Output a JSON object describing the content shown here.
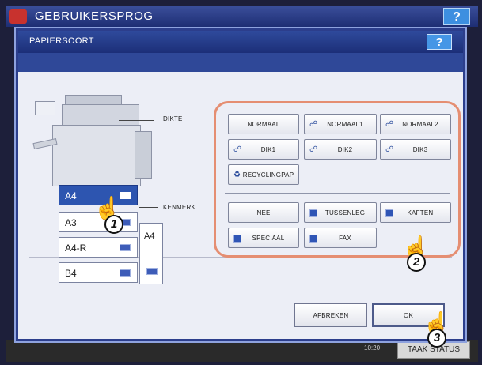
{
  "background": {
    "title": "GEBRUIKERSPROG",
    "help_label": "?",
    "date": "",
    "time": "10:20",
    "task_button_label": "TAAK STATUS"
  },
  "dialog": {
    "title": "PAPIERSOORT",
    "help_label": "?"
  },
  "labels": {
    "thickness": "DIKTE",
    "attribute": "KENMERK"
  },
  "drawers": [
    {
      "label": "A4",
      "selected": true
    },
    {
      "label": "A3",
      "selected": false
    },
    {
      "label": "A4-R",
      "selected": false
    },
    {
      "label": "B4",
      "selected": false
    }
  ],
  "bypass": {
    "label": "A4"
  },
  "thickness_options": [
    {
      "label": "NORMAAL",
      "icon": "none"
    },
    {
      "label": "NORMAAL1",
      "icon": "paper-curl-icon"
    },
    {
      "label": "NORMAAL2",
      "icon": "paper-curl-icon"
    },
    {
      "label": "DIK1",
      "icon": "paper-curl-icon"
    },
    {
      "label": "DIK2",
      "icon": "paper-curl-icon"
    },
    {
      "label": "DIK3",
      "icon": "paper-curl-icon"
    },
    {
      "label": "RECYCLINGPAP",
      "icon": "recycle-icon"
    }
  ],
  "attribute_options": [
    {
      "label": "NEE",
      "icon": "none"
    },
    {
      "label": "TUSSENLEG",
      "icon": "square-icon"
    },
    {
      "label": "KAFTEN",
      "icon": "square-icon"
    },
    {
      "label": "SPECIAAL",
      "icon": "square-icon"
    },
    {
      "label": "FAX",
      "icon": "square-icon"
    }
  ],
  "buttons": {
    "cancel_label": "AFBREKEN",
    "ok_label": "OK"
  },
  "callouts": [
    "1",
    "2",
    "3"
  ],
  "colors": {
    "title_bar": "#1f3380",
    "selected_drawer": "#2d55b0",
    "highlight_outline": "#e58e72"
  }
}
